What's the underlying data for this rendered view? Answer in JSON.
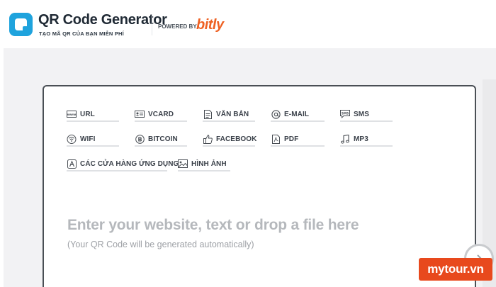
{
  "header": {
    "title": "QR Code Generator",
    "subtitle": "TẠO MÃ QR CỦA BẠN MIỄN PHÍ",
    "powered_by": "POWERED BY",
    "partner_logo": "bitly"
  },
  "colors": {
    "brand": "#1fa3dd",
    "partner": "#ee6123",
    "watermark": "#e8491d"
  },
  "tabs": [
    {
      "label": "URL",
      "icon": "url-icon"
    },
    {
      "label": "VCARD",
      "icon": "vcard-icon"
    },
    {
      "label": "VĂN BẢN",
      "icon": "text-document-icon"
    },
    {
      "label": "E-MAIL",
      "icon": "at-sign-icon"
    },
    {
      "label": "SMS",
      "icon": "sms-icon"
    },
    {
      "label": "WIFI",
      "icon": "wifi-icon"
    },
    {
      "label": "BITCOIN",
      "icon": "bitcoin-icon"
    },
    {
      "label": "FACEBOOK",
      "icon": "thumbs-up-icon"
    },
    {
      "label": "PDF",
      "icon": "pdf-icon"
    },
    {
      "label": "MP3",
      "icon": "music-note-icon"
    },
    {
      "label": "CÁC CỬA HÀNG ỨNG DỤNG",
      "icon": "app-store-icon"
    },
    {
      "label": "HÌNH ẢNH",
      "icon": "image-icon"
    }
  ],
  "input": {
    "prompt": "Enter your website, text or drop a file here",
    "hint": "(Your QR Code will be generated automatically)"
  },
  "watermark": "mytour.vn"
}
